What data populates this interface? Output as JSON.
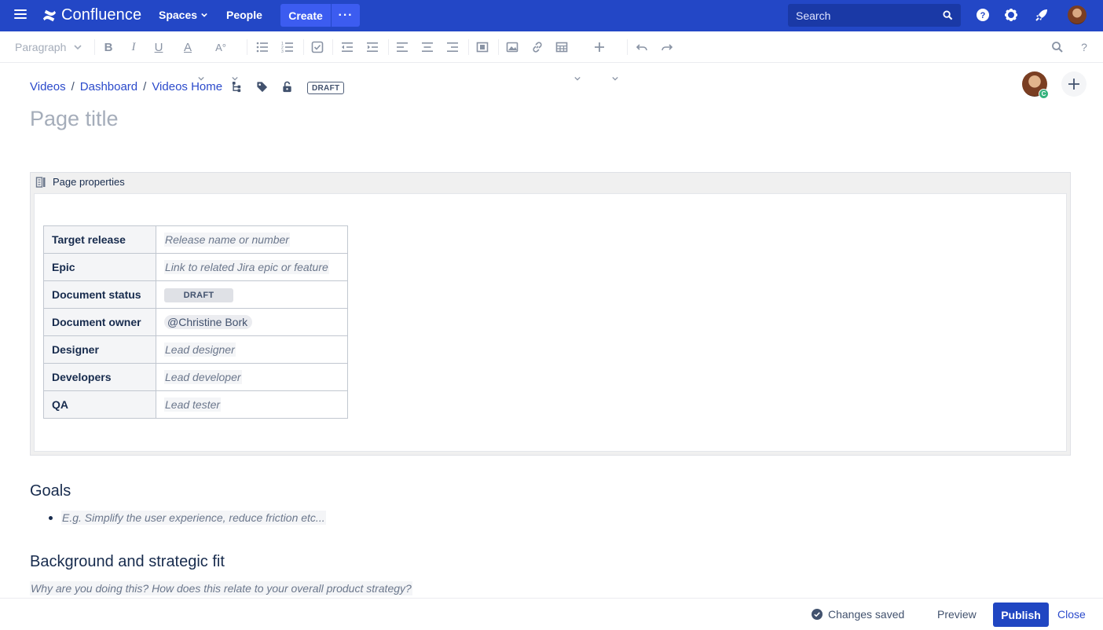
{
  "nav": {
    "brand": "Confluence",
    "spaces": "Spaces",
    "people": "People",
    "create": "Create",
    "more": "···",
    "search_placeholder": "Search"
  },
  "toolbar": {
    "paragraph": "Paragraph"
  },
  "breadcrumb": [
    "Videos",
    "Dashboard",
    "Videos Home"
  ],
  "draft_badge": "DRAFT",
  "page_title_placeholder": "Page title",
  "author_badge": "C",
  "macro": {
    "title": "Page properties",
    "rows": [
      {
        "key": "Target release",
        "value": "Release name or number"
      },
      {
        "key": "Epic",
        "value": "Link to related Jira epic or feature"
      },
      {
        "key": "Document status",
        "value": "DRAFT"
      },
      {
        "key": "Document owner",
        "value": "@Christine Bork"
      },
      {
        "key": "Designer",
        "value": "Lead designer"
      },
      {
        "key": "Developers",
        "value": "Lead developer"
      },
      {
        "key": "QA",
        "value": "Lead tester"
      }
    ]
  },
  "goals": {
    "heading": "Goals",
    "item": "E.g. Simplify the user experience, reduce friction etc..."
  },
  "background": {
    "heading": "Background and strategic fit",
    "text": "Why are you doing this? How does this relate to your overall product strategy?"
  },
  "footer": {
    "saved": "Changes saved",
    "preview": "Preview",
    "publish": "Publish",
    "close": "Close"
  },
  "colors": {
    "nav_bg": "#2347c6",
    "create_bg": "#3c5cf0",
    "publish_bg": "#2046c2",
    "link": "#2b4acb"
  }
}
